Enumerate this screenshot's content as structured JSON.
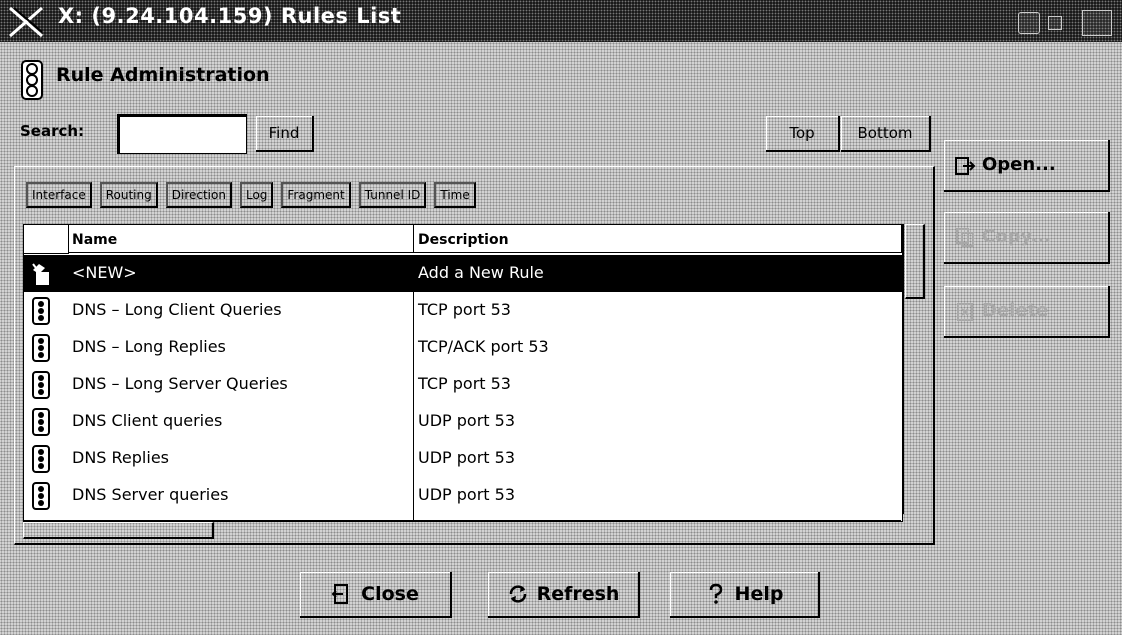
{
  "window": {
    "title": "X: (9.24.104.159) Rules List"
  },
  "header": {
    "title": "Rule Administration"
  },
  "search": {
    "label": "Search:",
    "value": "",
    "find_label": "Find",
    "top_label": "Top",
    "bottom_label": "Bottom"
  },
  "tabs": [
    "Interface",
    "Routing",
    "Direction",
    "Log",
    "Fragment",
    "Tunnel ID",
    "Time"
  ],
  "table": {
    "columns": {
      "name": "Name",
      "description": "Description"
    },
    "rows": [
      {
        "name": "<NEW>",
        "description": "Add a New Rule",
        "icon": "new-rule-icon",
        "selected": true
      },
      {
        "name": "DNS – Long Client Queries",
        "description": "TCP port 53",
        "icon": "traffic-light-icon"
      },
      {
        "name": "DNS – Long Replies",
        "description": "TCP/ACK port 53",
        "icon": "traffic-light-icon"
      },
      {
        "name": "DNS – Long Server Queries",
        "description": "TCP port 53",
        "icon": "traffic-light-icon"
      },
      {
        "name": "DNS Client queries",
        "description": "UDP port 53",
        "icon": "traffic-light-icon"
      },
      {
        "name": "DNS Replies",
        "description": "UDP port 53",
        "icon": "traffic-light-icon"
      },
      {
        "name": "DNS Server queries",
        "description": "UDP port 53",
        "icon": "traffic-light-icon"
      }
    ]
  },
  "actions": {
    "open": "Open...",
    "copy": "Copy...",
    "delete": "Delete"
  },
  "footer": {
    "close": "Close",
    "refresh": "Refresh",
    "help": "Help"
  },
  "colors": {
    "titlebar": "#1a1a1a",
    "background": "#d2d2d2",
    "selected_row": "#000000",
    "disabled_text": "#a8a8a8"
  }
}
